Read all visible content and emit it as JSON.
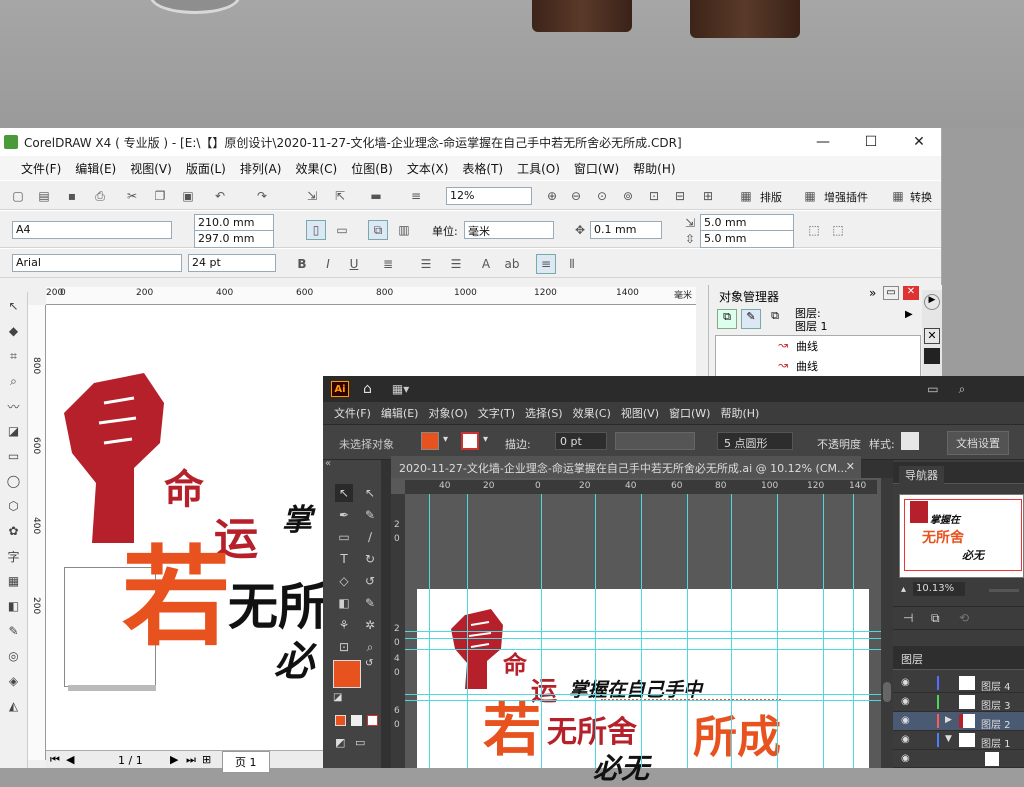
{
  "corel": {
    "title": "CorelDRAW X4 ( 专业版 ) - [E:\\【】原创设计\\2020-11-27-文化墙-企业理念-命运掌握在自己手中若无所舍必无所成.CDR]",
    "window_controls": [
      "—",
      "☐",
      "✕"
    ],
    "menu": [
      "文件(F)",
      "编辑(E)",
      "视图(V)",
      "版面(L)",
      "排列(A)",
      "效果(C)",
      "位图(B)",
      "文本(X)",
      "表格(T)",
      "工具(O)",
      "窗口(W)",
      "帮助(H)"
    ],
    "zoom": "12%",
    "toolbar_buttons": {
      "layout": "排版",
      "plugin": "增强插件",
      "convert": "转换"
    },
    "page_size": "A4",
    "width": "210.0 mm",
    "height": "297.0 mm",
    "unit_label": "单位:",
    "unit": "毫米",
    "nudge": "0.1 mm",
    "dup_x": "5.0 mm",
    "dup_y": "5.0 mm",
    "font": "Arial",
    "font_size": "24 pt",
    "ruler_h": [
      "400",
      "200",
      "0",
      "200",
      "400",
      "600",
      "800",
      "1000",
      "1200",
      "1400"
    ],
    "ruler_unit": "毫米",
    "ruler_v": [
      "800",
      "600",
      "400",
      "200"
    ],
    "docker_title": "对象管理器",
    "docker_layer": "图层:",
    "docker_layer_name": "图层 1",
    "docker_items": [
      "曲线",
      "曲线"
    ],
    "status_page": "1 / 1",
    "status_tab": "页 1"
  },
  "artwork": {
    "ming": "命",
    "yun": "运",
    "zhang": "掌",
    "ruo": "若",
    "wusuo": "无所",
    "bi": "必"
  },
  "ai": {
    "logo": "Ai",
    "menu": [
      "文件(F)",
      "编辑(E)",
      "对象(O)",
      "文字(T)",
      "选择(S)",
      "效果(C)",
      "视图(V)",
      "窗口(W)",
      "帮助(H)"
    ],
    "no_selection": "未选择对象",
    "stroke_label": "描边:",
    "stroke_value": "0 pt",
    "brush": "5 点圆形",
    "opacity_label": "不透明度",
    "style_label": "样式:",
    "doc_settings": "文档设置",
    "tab_title": "2020-11-27-文化墙-企业理念-命运掌握在自己手中若无所舍必无所成.ai @ 10.12% (CM...",
    "ruler_h": [
      "40",
      "20",
      "0",
      "20",
      "40",
      "60",
      "80",
      "100",
      "120",
      "140"
    ],
    "ruler_v": [
      "2",
      "0",
      "2",
      "0",
      "4",
      "0",
      "6",
      "0"
    ],
    "navigator_label": "导航器",
    "nav_zoom": "10.13%",
    "layers_label": "图层",
    "layers": [
      "图层 4",
      "图层 3",
      "图层 2",
      "图层 1"
    ],
    "art": {
      "ming": "命",
      "yun": "运",
      "slogan": "掌握在自己手中",
      "ruo": "若",
      "wusuoshe": "无所舍",
      "suocheng": "所成",
      "bi": "必无"
    },
    "nav_art": {
      "line1": "掌握在",
      "line2": "无所舍",
      "line3": "必无"
    }
  },
  "colors": {
    "red": "#b5202a",
    "orange": "#e8521f",
    "guide": "#4fd8e0"
  }
}
